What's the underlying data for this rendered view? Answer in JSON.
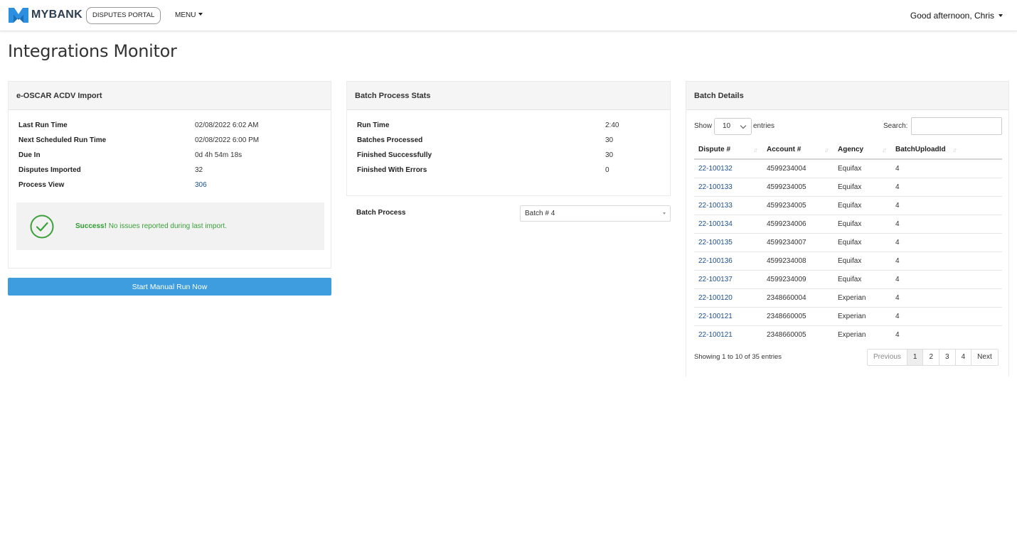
{
  "header": {
    "brand": "MYBANK",
    "portal": "DISPUTES PORTAL",
    "menu": "MENU",
    "greeting": "Good afternoon, Chris",
    "logo_color": "#2d8fe0"
  },
  "page": {
    "title": "Integrations Monitor"
  },
  "import_panel": {
    "title": "e-OSCAR ACDV Import",
    "rows": [
      {
        "label": "Last Run Time",
        "value": "02/08/2022 6:02 AM"
      },
      {
        "label": "Next Scheduled Run Time",
        "value": "02/08/2022 6:00 PM"
      },
      {
        "label": "Due In",
        "value": "0d 4h 54m 18s"
      },
      {
        "label": "Disputes Imported",
        "value": "32"
      },
      {
        "label": "Process View",
        "value": "306"
      }
    ],
    "success_strong": "Success!",
    "success_text": " No issues reported during last import.",
    "button_label": "Start Manual Run Now",
    "success_color": "#3aa03a",
    "button_color": "#3e9ddf"
  },
  "stats_panel": {
    "title": "Batch Process Stats",
    "rows": [
      {
        "label": "Run Time",
        "value": "2:40"
      },
      {
        "label": "Batches Processed",
        "value": "30"
      },
      {
        "label": "Finished Successfully",
        "value": "30"
      },
      {
        "label": "Finished With Errors",
        "value": "0"
      }
    ],
    "batch_process_label": "Batch Process",
    "batch_process_selected": "Batch # 4"
  },
  "details_panel": {
    "title": "Batch Details",
    "show_label": "Show",
    "page_length": "10",
    "entries_label": "entries",
    "search_label": "Search:",
    "search_value": "",
    "columns": [
      "Dispute #",
      "Account #",
      "Agency",
      "BatchUploadId"
    ],
    "rows": [
      [
        "22-100132",
        "4599234004",
        "Equifax",
        "4"
      ],
      [
        "22-100133",
        "4599234005",
        "Equifax",
        "4"
      ],
      [
        "22-100133",
        "4599234005",
        "Equifax",
        "4"
      ],
      [
        "22-100134",
        "4599234006",
        "Equifax",
        "4"
      ],
      [
        "22-100135",
        "4599234007",
        "Equifax",
        "4"
      ],
      [
        "22-100136",
        "4599234008",
        "Equifax",
        "4"
      ],
      [
        "22-100137",
        "4599234009",
        "Equifax",
        "4"
      ],
      [
        "22-100120",
        "2348660004",
        "Experian",
        "4"
      ],
      [
        "22-100121",
        "2348660005",
        "Experian",
        "4"
      ],
      [
        "22-100121",
        "2348660005",
        "Experian",
        "4"
      ]
    ],
    "info": "Showing 1 to 10 of 35 entries",
    "pager": {
      "previous": "Previous",
      "pages": [
        "1",
        "2",
        "3",
        "4"
      ],
      "active_page": "1",
      "next": "Next"
    }
  }
}
